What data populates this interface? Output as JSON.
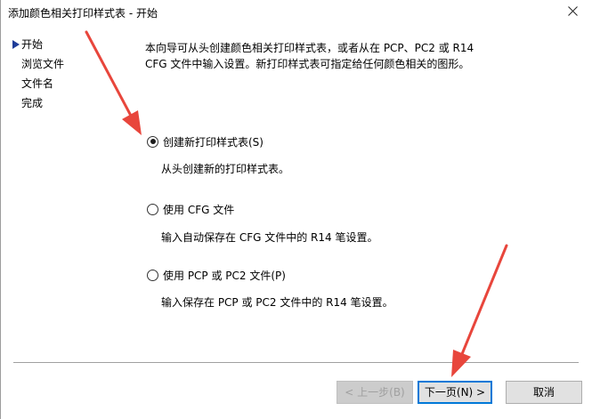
{
  "window": {
    "title": "添加颜色相关打印样式表 - 开始"
  },
  "nav": {
    "items": [
      "开始",
      "浏览文件",
      "文件名",
      "完成"
    ],
    "active_index": 0
  },
  "intro_lines": [
    "本向导可从头创建颜色相关打印样式表，或者从在 PCP、PC2 或 R14",
    "CFG 文件中输入设置。新打印样式表可指定给任何颜色相关的图形。"
  ],
  "options": [
    {
      "label": "创建新打印样式表(S)",
      "desc": "从头创建新的打印样式表。",
      "checked": true
    },
    {
      "label": "使用 CFG 文件",
      "desc": "输入自动保存在 CFG 文件中的 R14 笔设置。",
      "checked": false
    },
    {
      "label": "使用 PCP 或 PC2 文件(P)",
      "desc": "输入保存在 PCP 或 PC2 文件中的 R14 笔设置。",
      "checked": false
    }
  ],
  "buttons": {
    "back": "< 上一步(B)",
    "next": "下一页(N) >",
    "cancel": "取消"
  },
  "colors": {
    "annotation_arrow": "#e8463c",
    "nav_marker": "#1f3d99",
    "default_button_border": "#0078d7"
  }
}
